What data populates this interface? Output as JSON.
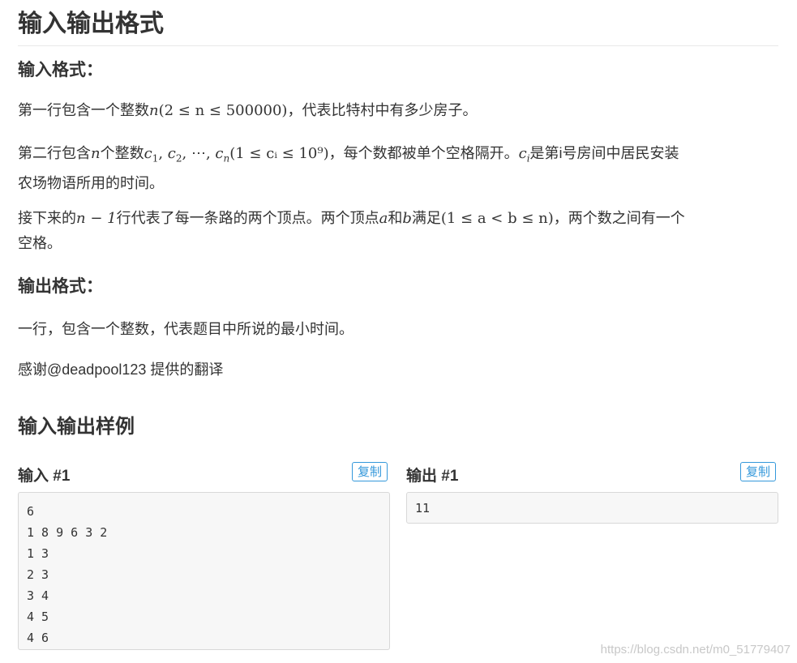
{
  "io_format": {
    "title": "输入输出格式",
    "input_heading": "输入格式：",
    "line1": {
      "pre": "第一行包含一个整数",
      "math": "(2 ≤ n ≤ 500000)",
      "post": "，代表比特村中有多少房子。"
    },
    "line2": {
      "pre": "第二行包含",
      "mid": "个整数",
      "math": "(1 ≤ cᵢ ≤ 10⁹)",
      "post": "，每个数都被单个空格隔开。",
      "post2": "是第i号房间中居民安装",
      "wrap": "农场物语所用的时间。"
    },
    "line3": {
      "pre": "接下来的",
      "math1": "n − 1",
      "mid1": "行代表了每一条路的两个顶点。两个顶点",
      "a": "a",
      "mid2": "和",
      "b": "b",
      "mid3": "满足",
      "math2": "(1 ≤ a < b ≤ n)",
      "post": "，两个数之间有一个",
      "wrap": "空格。"
    },
    "output_heading": "输出格式：",
    "output_line": "一行，包含一个整数，代表题目中所说的最小时间。",
    "credit": "感谢@deadpool123 提供的翻译"
  },
  "samples": {
    "title": "输入输出样例",
    "input_label": "输入 #1",
    "output_label": "输出 #1",
    "copy_label": "复制",
    "input_lines": [
      "6",
      "1 8 9 6 3 2",
      "1 3",
      "2 3",
      "3 4",
      "4 5",
      "4 6"
    ],
    "output_lines": [
      "11"
    ]
  },
  "watermark": "https://blog.csdn.net/m0_51779407"
}
